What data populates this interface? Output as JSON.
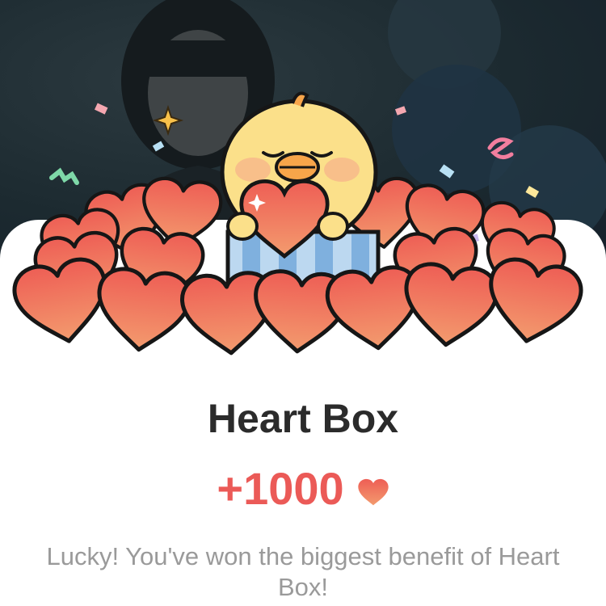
{
  "reward": {
    "title": "Heart Box",
    "amount": "+1000",
    "message": "Lucky! You've won the biggest benefit of Heart Box!"
  },
  "icons": {
    "amount_icon": "heart-icon",
    "mascot": "chick-mascot"
  },
  "colors": {
    "accent": "#eb5a57",
    "heart_fill": "#f0795c",
    "heart_outline": "#1a1a1a",
    "chick": "#fbe08a",
    "title": "#2b2b2b",
    "message": "#9a9a9a"
  }
}
